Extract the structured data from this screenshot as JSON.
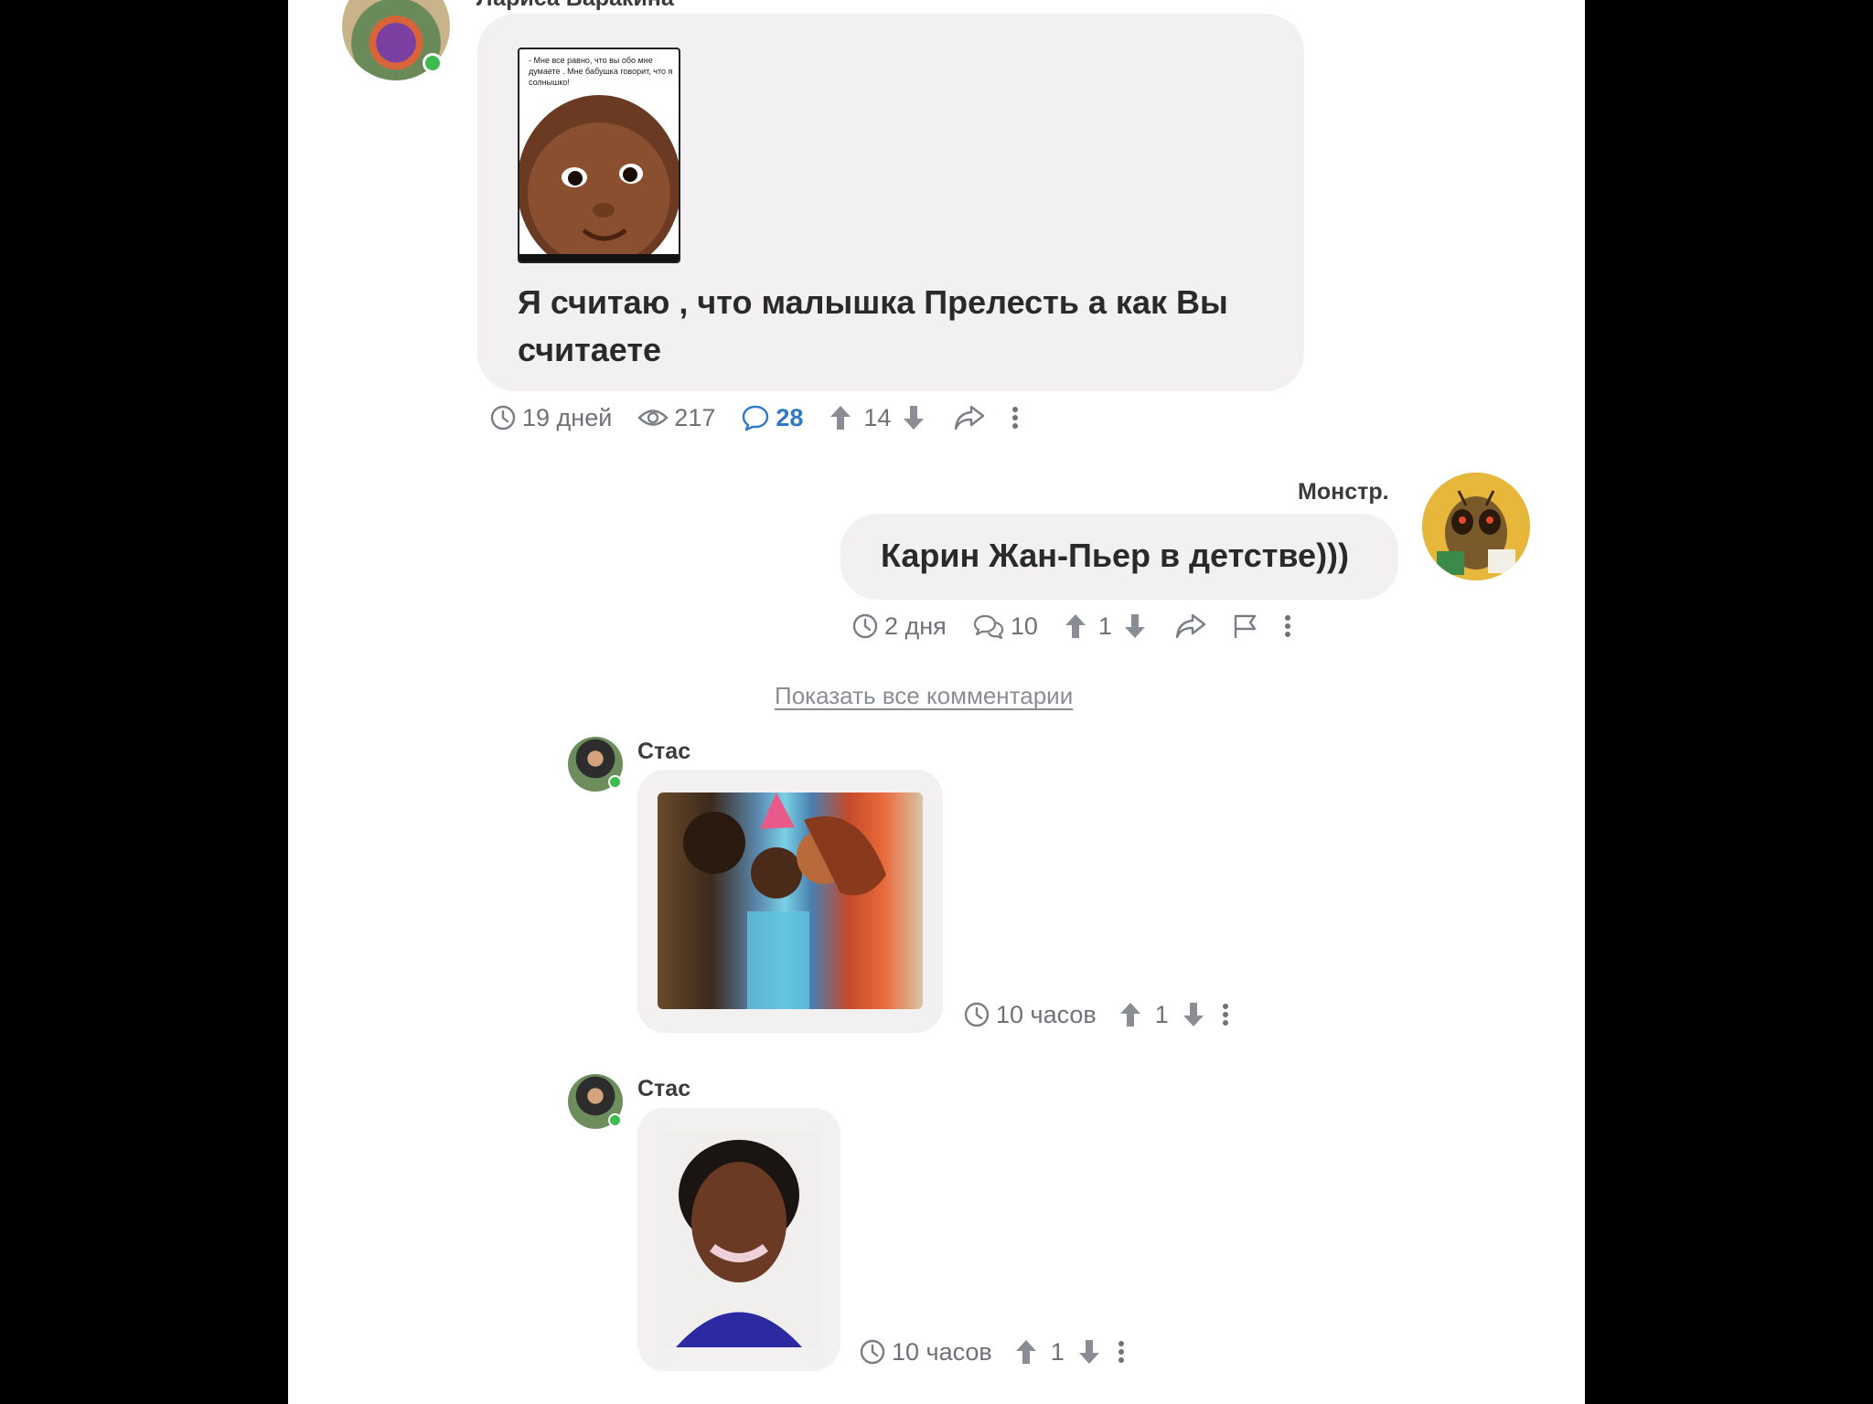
{
  "post": {
    "author": "Лариса Варакина",
    "image_caption": "- Мне все равно, что вы обо мне думаете . Мне бабушка говорит, что я солнышко!",
    "text": "Я считаю , что малышка Прелесть а как Вы считаете",
    "time": "19 дней",
    "views": "217",
    "comments": "28",
    "rating": "14"
  },
  "reply": {
    "author": "Монстр.",
    "text": "Карин Жан-Пьер в детстве)))",
    "time": "2 дня",
    "replies": "10",
    "rating": "1"
  },
  "show_all_label": "Показать все комментарии",
  "comments": [
    {
      "author": "Стас",
      "time": "10 часов",
      "rating": "1"
    },
    {
      "author": "Стас",
      "time": "10 часов",
      "rating": "1"
    }
  ],
  "colors": {
    "bubble": "#f2f0f0",
    "accent": "#2d79c7",
    "online": "#3dbb4f",
    "meta": "#6e7278"
  }
}
